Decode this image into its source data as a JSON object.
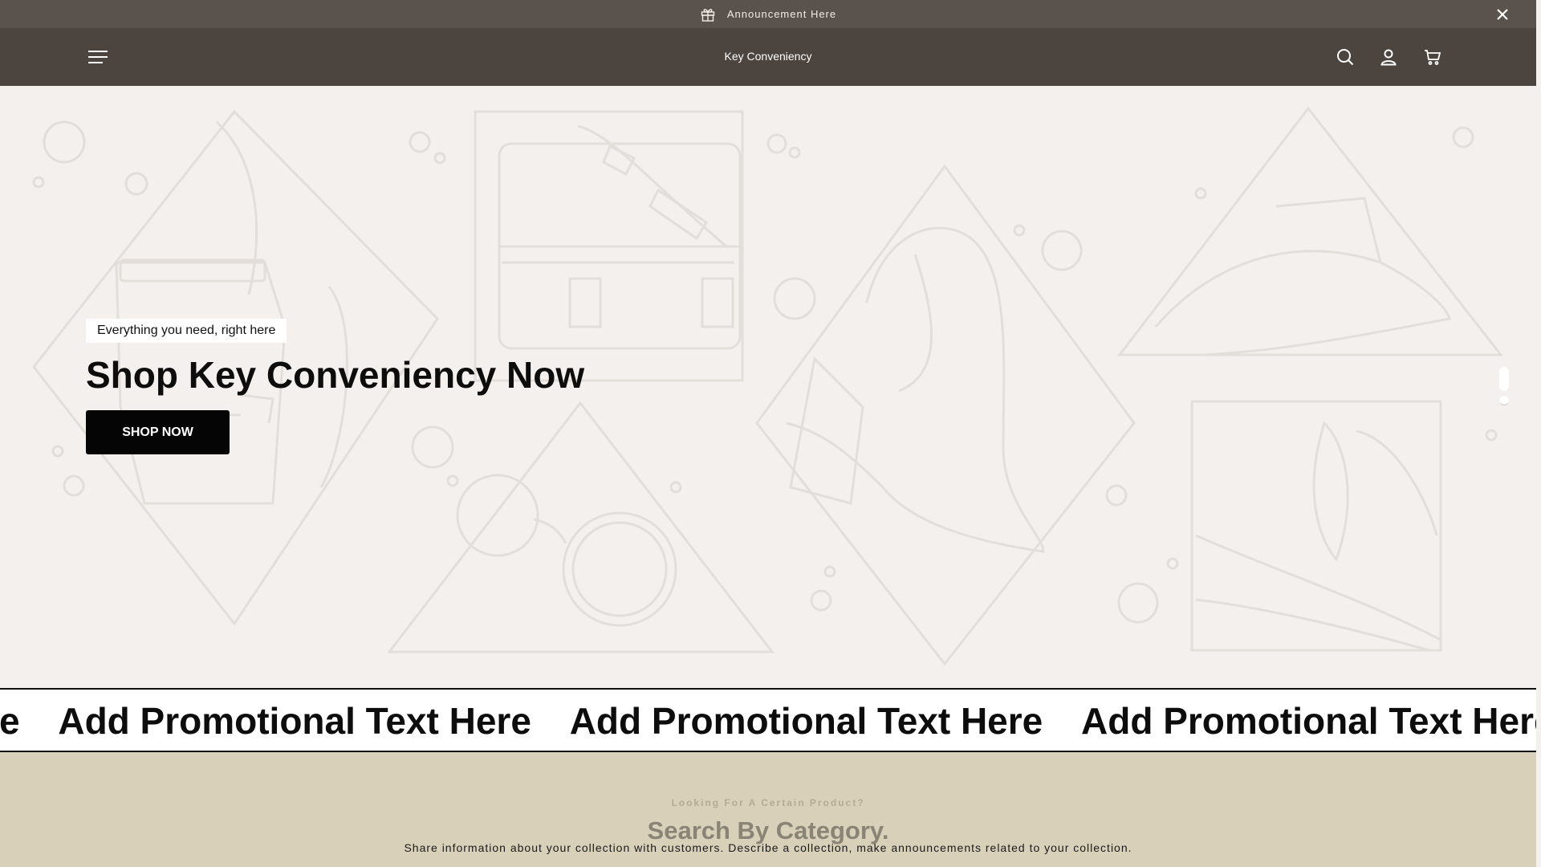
{
  "announcement": {
    "text": "Announcement Here",
    "icon": "gift-icon",
    "close_icon": "close-icon"
  },
  "header": {
    "brand": "Key Conveniency",
    "menu_icon": "hamburger-menu-icon",
    "search_icon": "search-icon",
    "account_icon": "user-icon",
    "cart_icon": "cart-icon"
  },
  "hero": {
    "subtitle": "Everything you need, right here",
    "title": "Shop Key Conveniency Now",
    "button_label": "SHOP NOW",
    "slides_total": 2,
    "active_slide": 1
  },
  "marquee": {
    "items": [
      "Add Promotional Text Here",
      "Add Promotional Text Here",
      "Add Promotional Text Here",
      "Add Promotional Text Here"
    ]
  },
  "category": {
    "eyebrow": "Looking For A Certain Product?",
    "heading": "Search By Category.",
    "description": "Share information about your collection with customers. Describe a collection, make announcements related to your collection."
  },
  "colors": {
    "announcement_bg": "#59524d",
    "header_bg": "#4b443f",
    "hero_bg": "#f3f0ed",
    "category_bg": "#d8d0b9",
    "button_bg": "#050505"
  }
}
